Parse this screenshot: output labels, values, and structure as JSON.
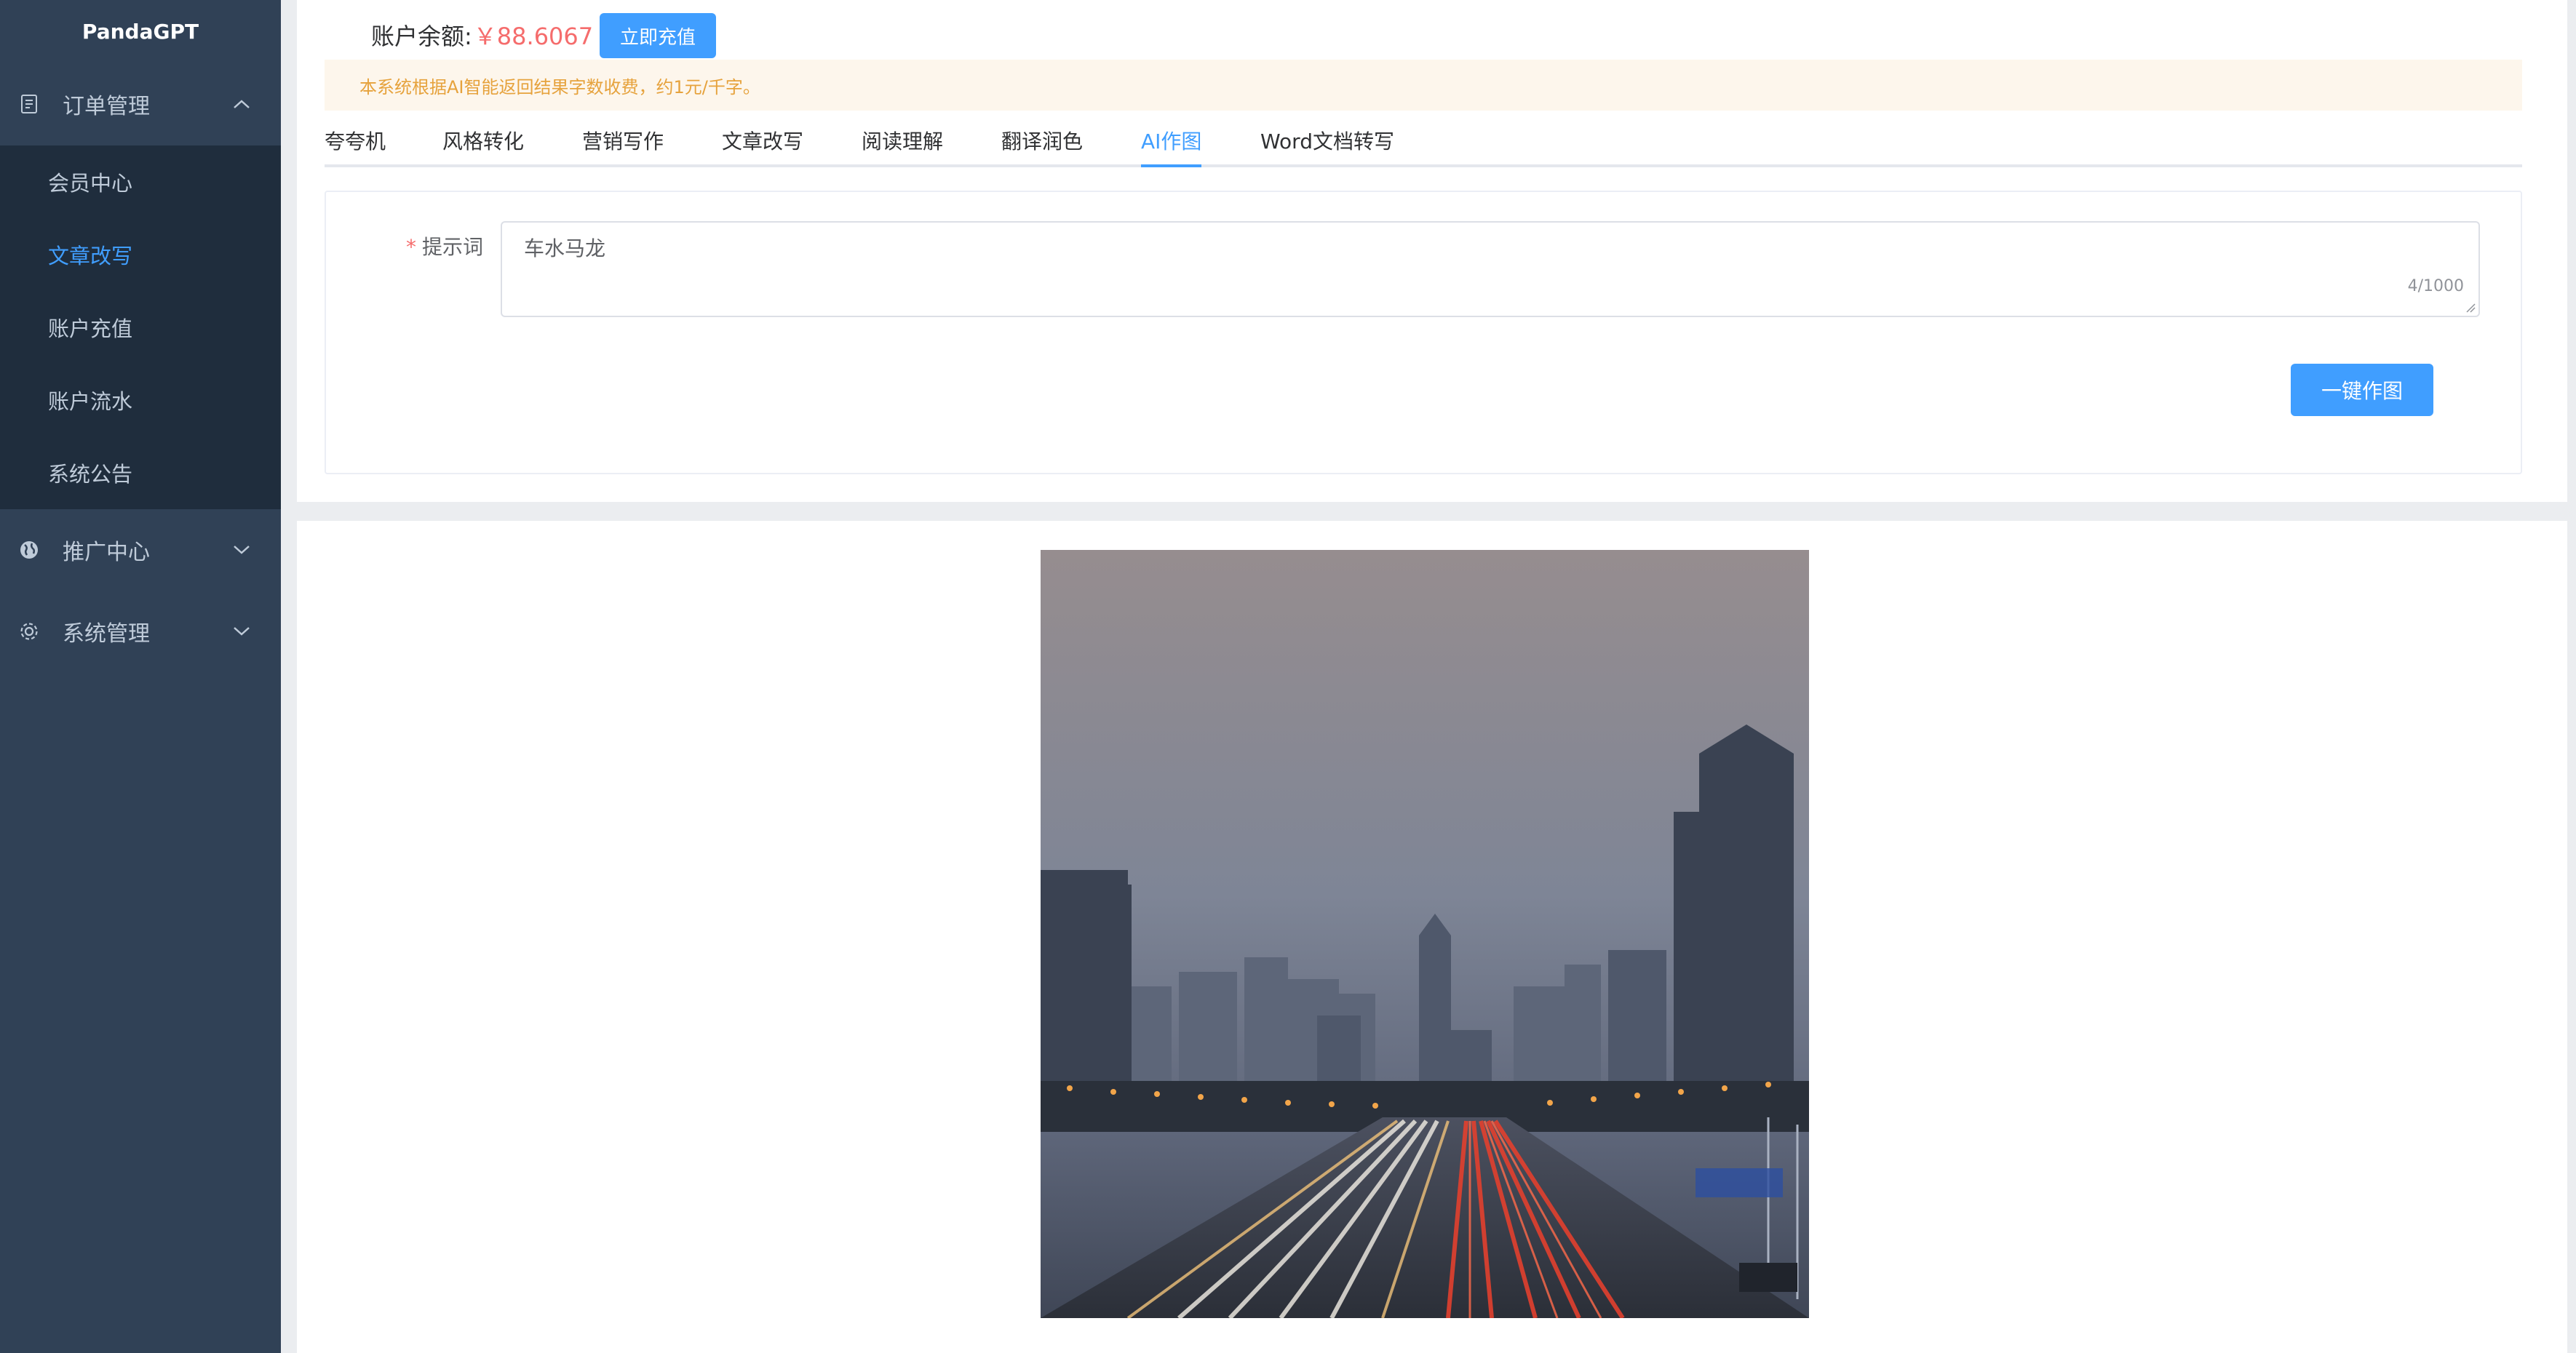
{
  "app": {
    "title": "PandaGPT"
  },
  "sidebar": {
    "groups": [
      {
        "label": "订单管理",
        "icon": "document-icon",
        "expanded": true,
        "items": [
          {
            "label": "会员中心",
            "active": false
          },
          {
            "label": "文章改写",
            "active": true
          },
          {
            "label": "账户充值",
            "active": false
          },
          {
            "label": "账户流水",
            "active": false
          },
          {
            "label": "系统公告",
            "active": false
          }
        ]
      },
      {
        "label": "推广中心",
        "icon": "globe-icon",
        "expanded": false
      },
      {
        "label": "系统管理",
        "icon": "gear-icon",
        "expanded": false
      }
    ]
  },
  "balance": {
    "label": "账户余额:",
    "value": "￥88.6067",
    "recharge_label": "立即充值"
  },
  "notice": {
    "text": "本系统根据AI智能返回结果字数收费，约1元/千字。"
  },
  "tabs": [
    {
      "label": "夸夸机",
      "active": false
    },
    {
      "label": "风格转化",
      "active": false
    },
    {
      "label": "营销写作",
      "active": false
    },
    {
      "label": "文章改写",
      "active": false
    },
    {
      "label": "阅读理解",
      "active": false
    },
    {
      "label": "翻译润色",
      "active": false
    },
    {
      "label": "AI作图",
      "active": true
    },
    {
      "label": "Word文档转写",
      "active": false
    }
  ],
  "form": {
    "prompt_label": "提示词",
    "prompt_value": "车水马龙",
    "counter": "4/1000",
    "generate_label": "一键作图"
  },
  "result": {
    "image": "city-highway-night-traffic-image"
  },
  "colors": {
    "sidebar_bg": "#304156",
    "submenu_bg": "#1f2d3d",
    "accent": "#409eff",
    "price": "#f56c6c",
    "notice_bg": "#fdf6ec",
    "notice_text": "#e6a23c"
  }
}
